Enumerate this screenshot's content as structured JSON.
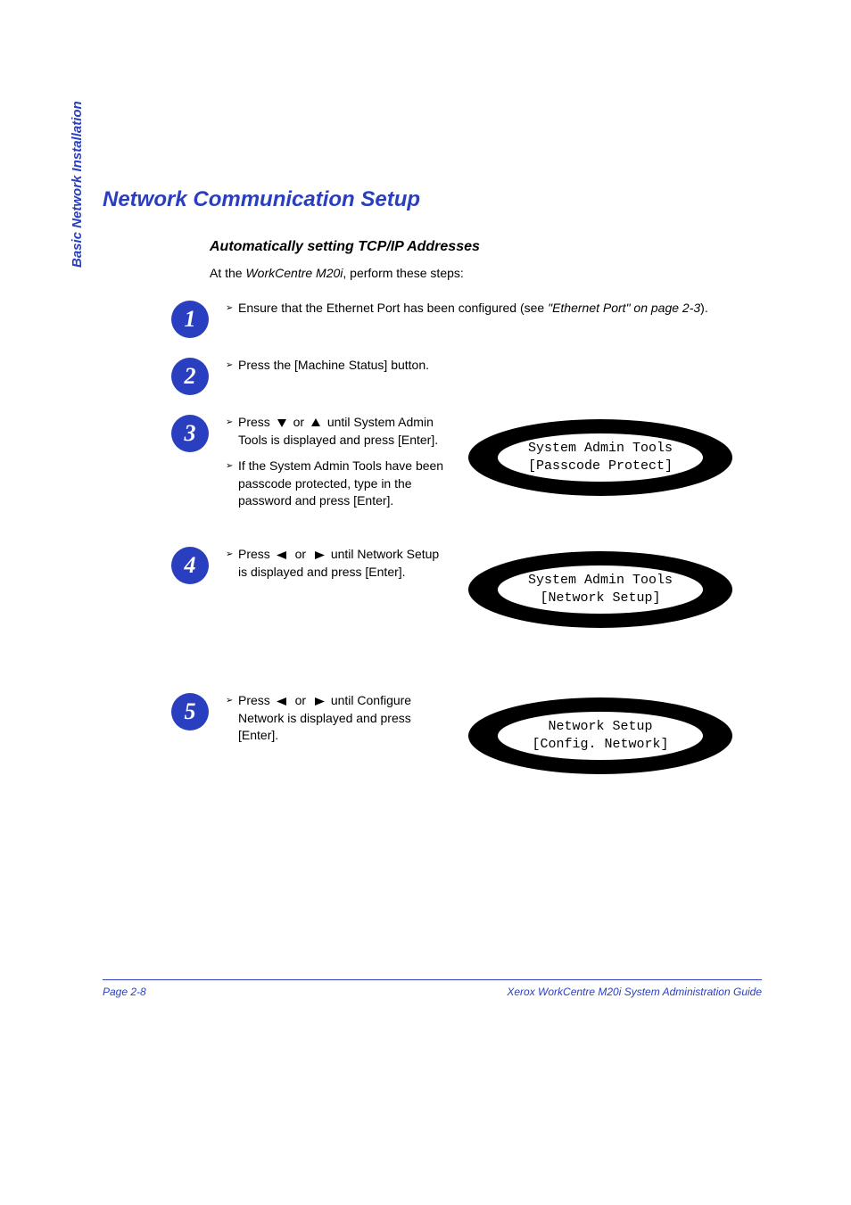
{
  "sidebar": {
    "label": "Basic Network Installation"
  },
  "heading": "Network Communication Setup",
  "subheading": "Automatically setting TCP/IP Addresses",
  "intro": {
    "prefix": "At the ",
    "device": "WorkCentre M20i",
    "suffix": ", perform these steps:"
  },
  "steps": {
    "s1": {
      "num": "1",
      "text_prefix": "Ensure that the Ethernet Port has been configured (see ",
      "ref": "\"Ethernet Port\" on page 2-3",
      "text_suffix": ")."
    },
    "s2": {
      "num": "2",
      "text": "Press the [Machine Status] button."
    },
    "s3": {
      "num": "3",
      "b1_prefix": "Press ",
      "b1_mid": " or ",
      "b1_suffix": " until System Admin Tools is displayed and press [Enter].",
      "b2": "If the System Admin Tools have been passcode protected, type in the password and press [Enter].",
      "lcd_line1": "System Admin Tools",
      "lcd_line2": "[Passcode Protect]"
    },
    "s4": {
      "num": "4",
      "b1_prefix": "Press ",
      "b1_mid": " or ",
      "b1_suffix": " until Network Setup is displayed and press [Enter].",
      "lcd_line1": "System Admin Tools",
      "lcd_line2": "[Network Setup]"
    },
    "s5": {
      "num": "5",
      "b1_prefix": "Press ",
      "b1_mid": " or ",
      "b1_suffix": " until Configure Network is displayed and press [Enter].",
      "lcd_line1": "Network Setup",
      "lcd_line2": "[Config. Network]"
    }
  },
  "footer": {
    "page": "Page 2-8",
    "doc": "Xerox WorkCentre M20i System Administration Guide"
  }
}
